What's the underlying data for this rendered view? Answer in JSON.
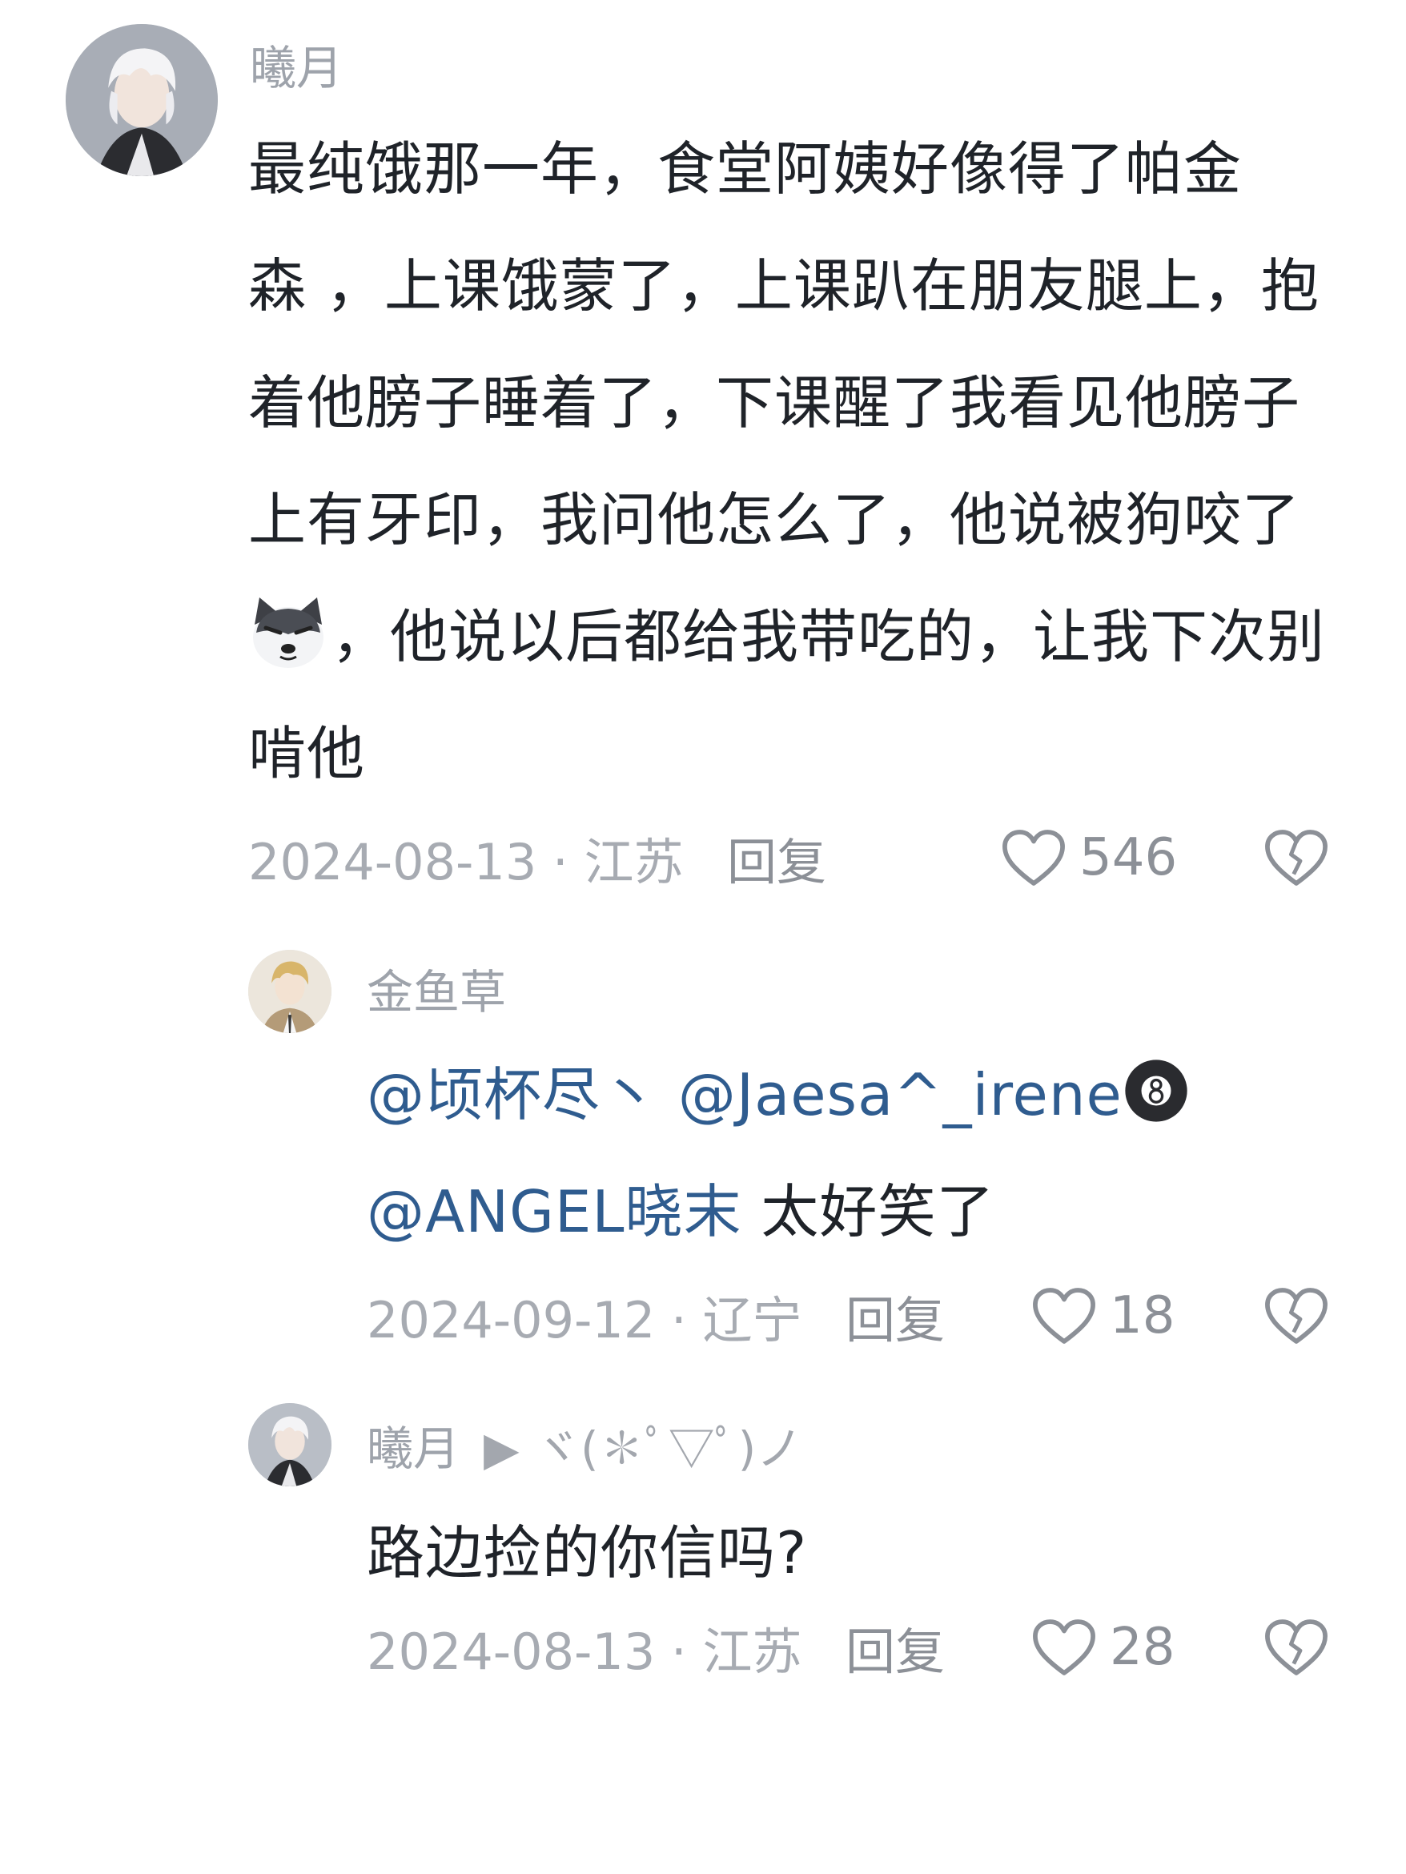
{
  "comments": [
    {
      "username": "曦月",
      "text_lines": [
        "最纯饿那一年，食堂阿姨好像得了帕金",
        "森 ，上课饿蒙了，上课趴在朋友腿上，抱",
        "着他膀子睡着了，下课醒了我看见他膀子",
        "上有牙印，我问他怎么了，他说被狗咬了",
        "，他说以后都给我带吃的，让我下次别",
        "啃他"
      ],
      "emoji_icon": "shiba-dog-emoji",
      "date_location": "2024-08-13 · 江苏",
      "reply_label": "回复",
      "likes": "546",
      "avatar_icon": "anime-boy-white-hair-avatar"
    }
  ],
  "replies": [
    {
      "username": "金鱼草",
      "mention_1": "@顷杯尽丶",
      "mention_2": "@Jaesa^_irene",
      "ball_icon": "billiard-8-ball-emoji",
      "mention_3": "@ANGEL晓末",
      "text": " 太好笑了",
      "date_location": "2024-09-12 · 辽宁",
      "reply_label": "回复",
      "likes": "18",
      "avatar_icon": "anime-boy-blonde-avatar"
    },
    {
      "username": "曦月",
      "reply_to": "▶  ヾ(✽ﾟ▽ﾟ)ノ",
      "text": "路边捡的你信吗?",
      "date_location": "2024-08-13 · 江苏",
      "reply_label": "回复",
      "likes": "28",
      "avatar_icon": "anime-boy-white-hair-avatar"
    }
  ],
  "colors": {
    "text": "#1f2329",
    "meta": "#a7abb2",
    "mention": "#2f5c8f"
  }
}
